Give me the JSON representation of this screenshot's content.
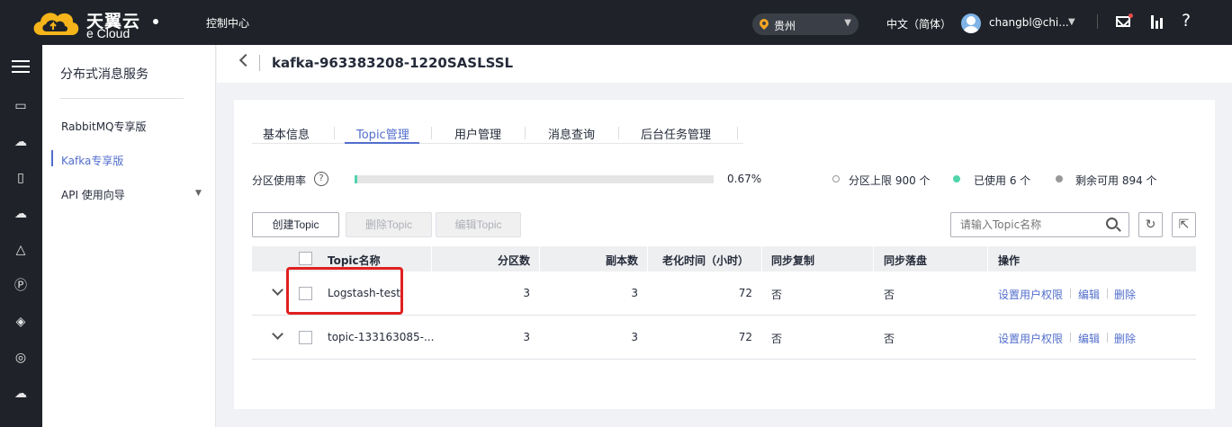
{
  "topbar": {
    "logo_cn": "天翼云",
    "logo_en": "e Cloud",
    "console": "控制中心",
    "region": "贵州",
    "language": "中文（简体）",
    "user": "changbl@chi..."
  },
  "sidebar": {
    "title": "分布式消息服务",
    "items": [
      {
        "label": "RabbitMQ专享版"
      },
      {
        "label": "Kafka专享版"
      },
      {
        "label": "API 使用向导"
      }
    ]
  },
  "header": {
    "title": "kafka-963383208-1220SASLSSL"
  },
  "tabs": [
    {
      "label": "基本信息"
    },
    {
      "label": "Topic管理"
    },
    {
      "label": "用户管理"
    },
    {
      "label": "消息查询"
    },
    {
      "label": "后台任务管理"
    }
  ],
  "usage": {
    "label": "分区使用率",
    "percent_text": "0.67%",
    "fraction": 0.0067,
    "limit": "分区上限 900 个",
    "used": "已使用 6 个",
    "remaining": "剩余可用 894 个"
  },
  "toolbar": {
    "create": "创建Topic",
    "delete": "删除Topic",
    "edit": "编辑Topic",
    "search_placeholder": "请输入Topic名称"
  },
  "table": {
    "columns": [
      "Topic名称",
      "分区数",
      "副本数",
      "老化时间（小时）",
      "同步复制",
      "同步落盘",
      "操作"
    ],
    "rows": [
      {
        "name": "Logstash-test",
        "partitions": "3",
        "replicas": "3",
        "aging": "72",
        "sync_rep": "否",
        "sync_disk": "否"
      },
      {
        "name": "topic-133163085-...",
        "partitions": "3",
        "replicas": "3",
        "aging": "72",
        "sync_rep": "否",
        "sync_disk": "否"
      }
    ],
    "actions": {
      "perm": "设置用户权限",
      "edit": "编辑",
      "delete": "删除"
    }
  },
  "colors": {
    "accent": "#526ecc",
    "used": "#50d4ab",
    "highlight": "#e02020"
  }
}
